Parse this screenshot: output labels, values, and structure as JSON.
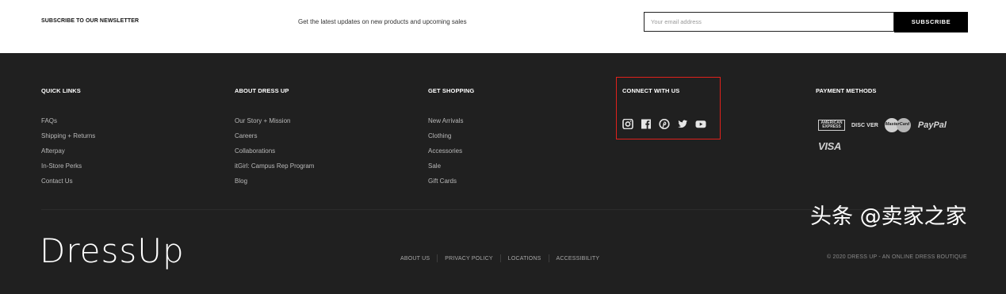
{
  "newsletter": {
    "title": "SUBSCRIBE TO OUR NEWSLETTER",
    "text": "Get the latest updates on new products and upcoming sales",
    "email_placeholder": "Your email address",
    "button_label": "SUBSCRIBE"
  },
  "footer": {
    "quick_links": {
      "title": "QUICK LINKS",
      "items": [
        "FAQs",
        "Shipping + Returns",
        "Afterpay",
        "In-Store Perks",
        "Contact Us"
      ]
    },
    "about": {
      "title": "ABOUT DRESS UP",
      "items": [
        "Our Story + Mission",
        "Careers",
        "Collaborations",
        "itGirl: Campus Rep Program",
        "Blog"
      ]
    },
    "shopping": {
      "title": "GET SHOPPING",
      "items": [
        "New Arrivals",
        "Clothing",
        "Accessories",
        "Sale",
        "Gift Cards"
      ]
    },
    "connect": {
      "title": "CONNECT WITH US",
      "icons": [
        "instagram-icon",
        "facebook-icon",
        "pinterest-icon",
        "twitter-icon",
        "youtube-icon"
      ]
    },
    "payment": {
      "title": "PAYMENT METHODS",
      "amex": "AMERICAN EXPRESS",
      "discover": "DISC VER",
      "mastercard": "MasterCard",
      "paypal": "PayPal",
      "visa": "VISA"
    },
    "logo": "DressUp",
    "bottom_links": [
      "ABOUT US",
      "PRIVACY POLICY",
      "LOCATIONS",
      "ACCESSIBILITY"
    ],
    "copyright": "© 2020 DRESS UP - AN ONLINE DRESS BOUTIQUE"
  },
  "watermark": "头条 @卖家之家",
  "colors": {
    "footer_bg": "#202020",
    "highlight_border": "#e0211c",
    "button_bg": "#000000"
  }
}
